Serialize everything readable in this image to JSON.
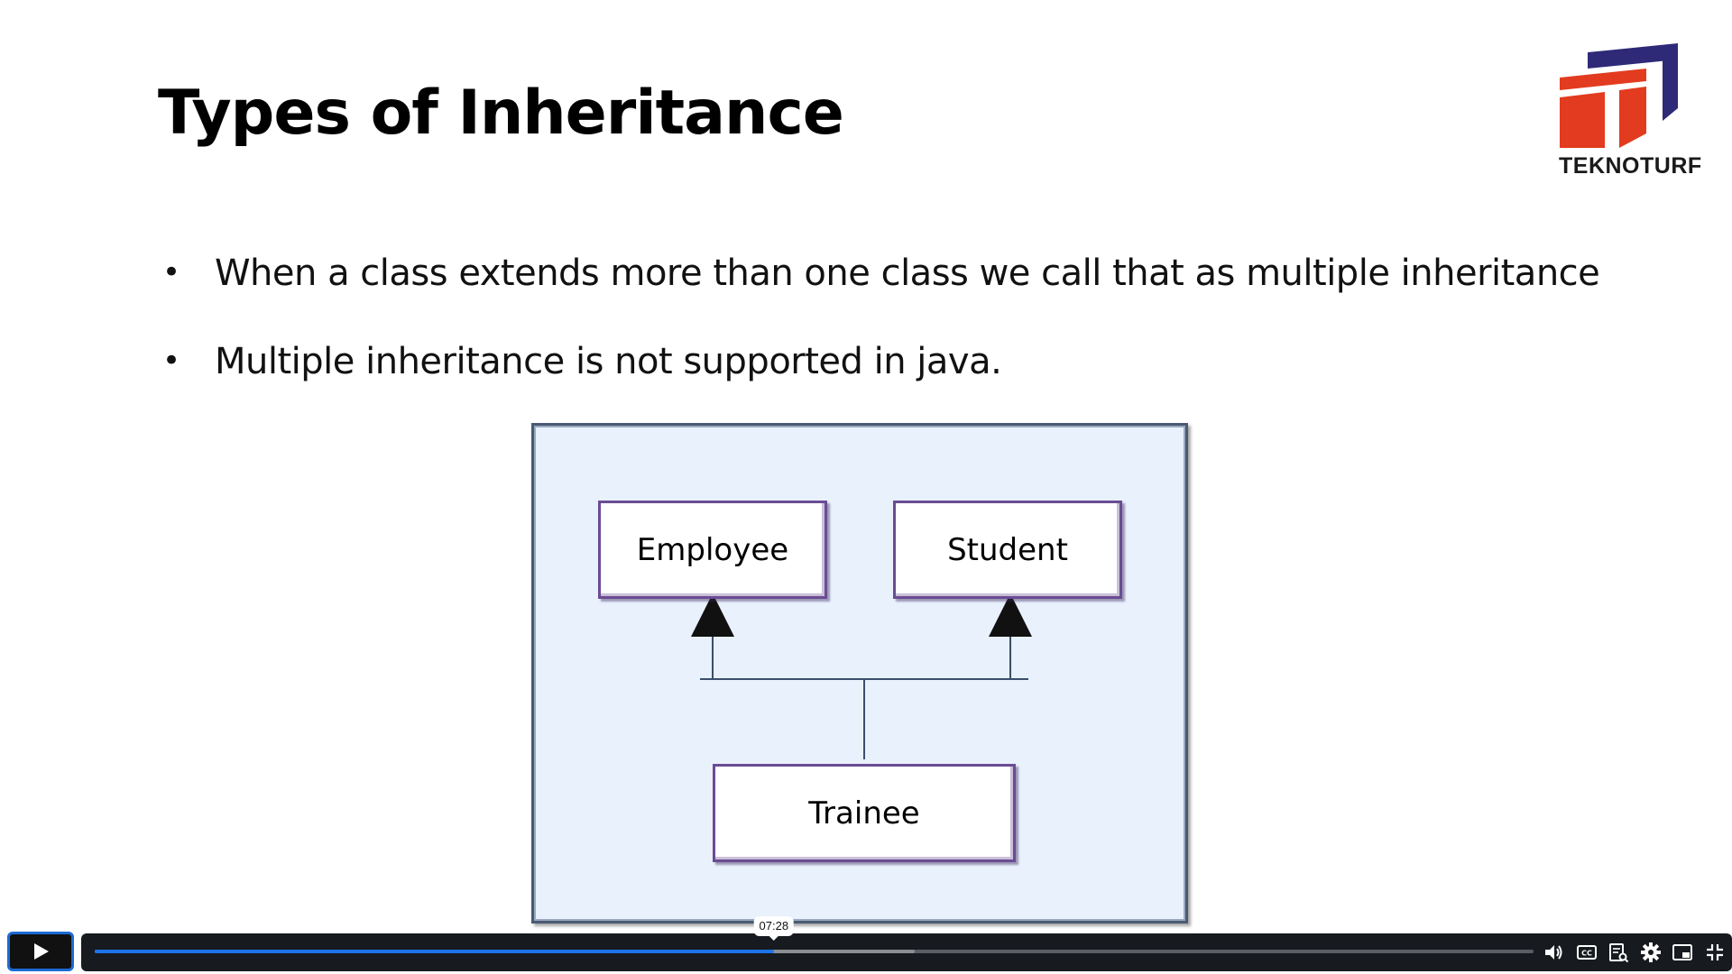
{
  "slide": {
    "title": "Types of Inheritance",
    "logo_text": "TEKNOTURF",
    "bullets": [
      "When a class extends more than one class we call that as multiple inheritance",
      "Multiple inheritance is not supported in java."
    ],
    "bullet_glyph": "•"
  },
  "diagram": {
    "parents": [
      "Employee",
      "Student"
    ],
    "child": "Trainee"
  },
  "player": {
    "hover_time": "07:28",
    "progress_played": 0.472,
    "progress_buffered": 0.57,
    "accent": "#1e73e8",
    "controls": [
      "play-icon",
      "volume-icon",
      "captions-icon",
      "transcript-icon",
      "settings-icon",
      "picture-in-picture-icon",
      "exit-fullscreen-icon"
    ]
  },
  "colors": {
    "logo_blue": "#2e2a78",
    "logo_red": "#e23b1f",
    "diagram_bg": "#e8f1fc",
    "box_border": "#6a4c93"
  }
}
